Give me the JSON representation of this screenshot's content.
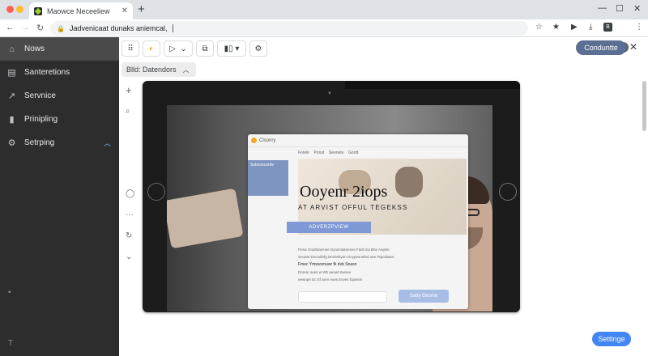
{
  "browser": {
    "tab_title": "Maowce Neceeliew",
    "url": "Jadvenicaat dunaks aniemcal,",
    "window_colors": {
      "red": "#ff5f57",
      "yellow": "#febc2e",
      "green": "#28c840"
    }
  },
  "sidebar": {
    "items": [
      {
        "label": "Nows",
        "icon": "home-icon"
      },
      {
        "label": "Santeretions",
        "icon": "calendar-icon"
      },
      {
        "label": "Servnice",
        "icon": "chart-icon"
      },
      {
        "label": "Prinipling",
        "icon": "bar-icon"
      },
      {
        "label": "Setrping",
        "icon": "gear-icon"
      }
    ],
    "footer_symbol": "T"
  },
  "toolbar": {
    "primary_pill": "Conduntte",
    "filter_chip": "Blld: Datendors"
  },
  "preview": {
    "inner_brand": "Clsonry",
    "inner_nav": [
      "Fotele",
      "Ponst",
      "Seenete",
      "Gordt"
    ],
    "side_card": "Subssocarde",
    "headline": "Ooyenr 2iops",
    "subheadline": "AT  ARVIST OFFUL TEGEKSS",
    "cta": "ADVERZPVIEW",
    "lines": [
      "Pcsw Gnahkasmee    Dynsmakneves    Ftafs  Ea Bhe   Aepsle",
      "Snoate  Dovodlnfg Deshebyan  Doypesnefed  xae  Tspcdiaien",
      "Fmec       Ymwvsmuwr  fk  dvb  Snasn",
      "Dnrenr         aves  w  Wb  aeowl   Swnne",
      "eewnpe   Dc  Ef     aren  eses   Evves   fopwsm"
    ],
    "secondary_button": "Satty Desme"
  },
  "floating_button": "Settinge"
}
